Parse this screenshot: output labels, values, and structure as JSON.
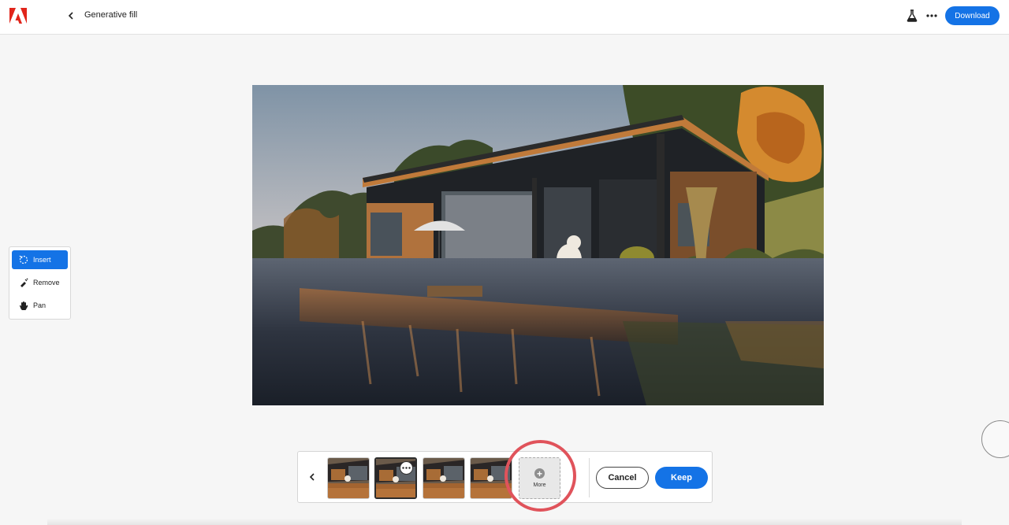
{
  "header": {
    "title": "Generative fill",
    "download_label": "Download",
    "brand_color": "#e1251b",
    "accent_color": "#1473e6"
  },
  "tools": [
    {
      "label": "Insert",
      "icon": "insert-brush-icon",
      "active": true
    },
    {
      "label": "Remove",
      "icon": "remove-brush-icon",
      "active": false
    },
    {
      "label": "Pan",
      "icon": "hand-icon",
      "active": false
    }
  ],
  "canvas": {
    "subject": "lakeside-cabin-with-dog-photo"
  },
  "variations": {
    "count": 4,
    "selected_index": 1,
    "more_label": "More",
    "cancel_label": "Cancel",
    "keep_label": "Keep",
    "highlight_color": "#e0535b"
  }
}
